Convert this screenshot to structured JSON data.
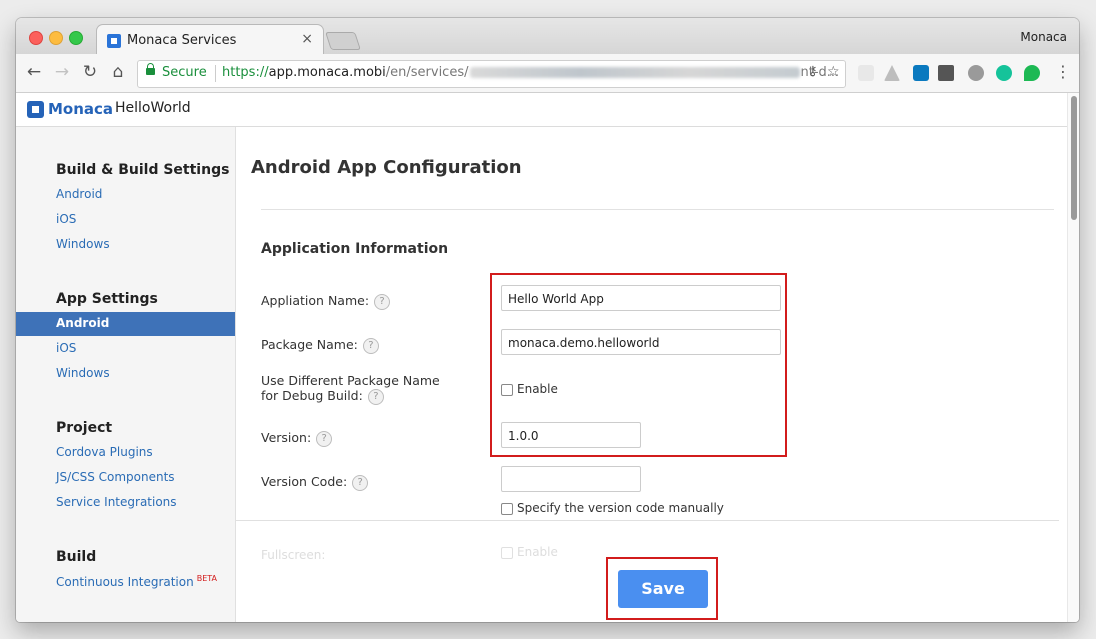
{
  "browser": {
    "tab_title": "Monaca Services",
    "tab_close": "×",
    "user_name": "Monaca",
    "secure_label": "Secure",
    "url_scheme": "https://",
    "url_host": "app.monaca.mobi",
    "url_path": "/en/services/",
    "url_path_end": "nt-d...",
    "nav_back": "←",
    "nav_forward": "→",
    "nav_reload": "↻",
    "nav_home": "⌂",
    "star": "☆",
    "key": "⚷",
    "menu": "⋮"
  },
  "app": {
    "brand": "Monaca",
    "project": "HelloWorld"
  },
  "sidebar": {
    "groups": [
      {
        "title": "Build & Build Settings",
        "items": [
          "Android",
          "iOS",
          "Windows"
        ]
      },
      {
        "title": "App Settings",
        "items": [
          "Android",
          "iOS",
          "Windows"
        ],
        "active": "Android"
      },
      {
        "title": "Project",
        "items": [
          "Cordova Plugins",
          "JS/CSS Components",
          "Service Integrations"
        ]
      },
      {
        "title": "Build",
        "items": [
          "Continuous Integration"
        ]
      }
    ],
    "beta_badge": "BETA"
  },
  "main": {
    "title": "Android App Configuration",
    "section": "Application Information",
    "help_glyph": "?",
    "fields": {
      "app_name": {
        "label": "Appliation Name:",
        "value": "Hello World App"
      },
      "package_name": {
        "label": "Package Name:",
        "value": "monaca.demo.helloworld"
      },
      "debug_package": {
        "label_line1": "Use Different Package Name",
        "label_line2": "for Debug Build:",
        "checkbox_label": "Enable",
        "checked": false
      },
      "version": {
        "label": "Version:",
        "value": "1.0.0"
      },
      "version_code": {
        "label": "Version Code:",
        "value": "",
        "checkbox_label": "Specify the version code manually",
        "checked": false
      },
      "fullscreen": {
        "label": "Fullscreen:",
        "checkbox_label": "Enable"
      }
    },
    "save_label": "Save"
  }
}
